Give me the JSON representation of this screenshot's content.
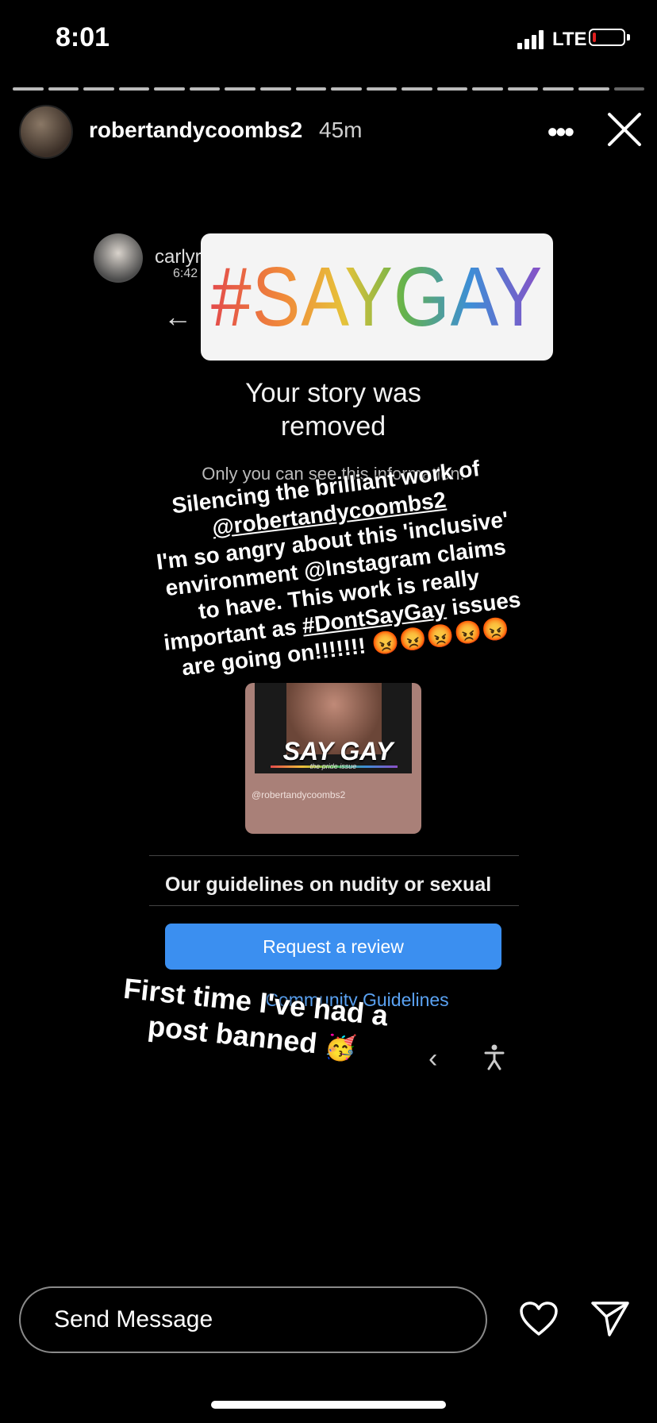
{
  "status_bar": {
    "time": "8:01",
    "network": "LTE"
  },
  "story_header": {
    "username": "robertandycoombs2",
    "time_ago": "45m"
  },
  "story_content": {
    "commenter_username": "carlyriegger",
    "commenter_time": "6:42",
    "hashtag_sticker": "#SAYGAY",
    "removed_title": "Your story was removed",
    "only_you": "Only you can see this information.",
    "caption_lines": [
      "Silencing the brilliant work of",
      "@robertandycoombs2",
      "I'm so angry about this 'inclusive'",
      "environment @Instagram claims",
      "to have. This work is really",
      "important as ",
      "#DontSayGay",
      " issues",
      "are going on!!!!!!! 😡😡😡😡😡"
    ],
    "post_title": "SAY GAY",
    "post_subtitle": "the pride issue",
    "post_handle": "@robertandycoombs2",
    "guidelines_heading": "Our guidelines on nudity or sexual",
    "request_review": "Request a review",
    "community_guidelines": "Community Guidelines",
    "caption2_line1": "First time I've had a",
    "caption2_line2": "post banned",
    "party_emoji": "🥳"
  },
  "bottom_bar": {
    "message_placeholder": "Send Message"
  },
  "icons": {
    "more": "more-icon",
    "close": "close-icon",
    "heart": "heart-icon",
    "send": "send-icon",
    "back": "back-arrow-icon",
    "chevron": "chevron-left-icon",
    "accessibility": "accessibility-icon"
  }
}
